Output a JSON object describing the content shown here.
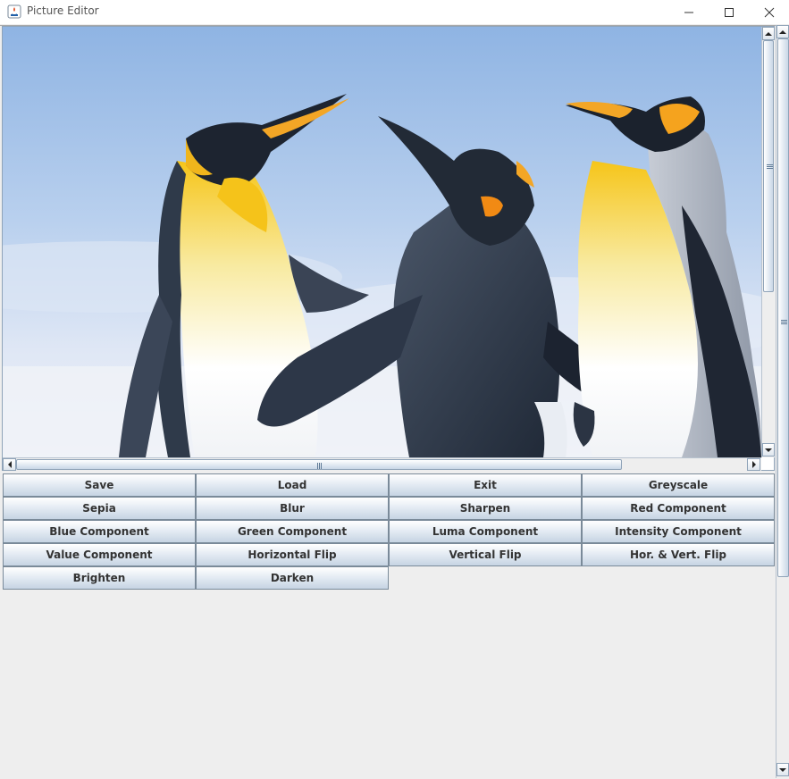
{
  "window": {
    "title": "Picture Editor",
    "controls": {
      "minimize": "minimize-icon",
      "maximize": "maximize-icon",
      "close": "close-icon"
    }
  },
  "image": {
    "subject": "penguins-photo",
    "colors": {
      "sky": "#a9c6ea",
      "body": "#2e3a4c",
      "belly": "#f3f1e6",
      "yellow": "#f5c61c",
      "orange": "#f2a21b"
    }
  },
  "buttons": [
    {
      "label": "Save"
    },
    {
      "label": "Load"
    },
    {
      "label": "Exit"
    },
    {
      "label": "Greyscale"
    },
    {
      "label": "Sepia"
    },
    {
      "label": "Blur"
    },
    {
      "label": "Sharpen"
    },
    {
      "label": "Red Component"
    },
    {
      "label": "Blue Component"
    },
    {
      "label": "Green Component"
    },
    {
      "label": "Luma Component"
    },
    {
      "label": "Intensity Component"
    },
    {
      "label": "Value Component"
    },
    {
      "label": "Horizontal Flip"
    },
    {
      "label": "Vertical Flip"
    },
    {
      "label": "Hor. & Vert. Flip"
    },
    {
      "label": "Brighten"
    },
    {
      "label": "Darken"
    }
  ],
  "theme": {
    "background": "#eeeeee",
    "button_border": "#7a8a99",
    "scrollbar_border": "#8fa3b8"
  }
}
